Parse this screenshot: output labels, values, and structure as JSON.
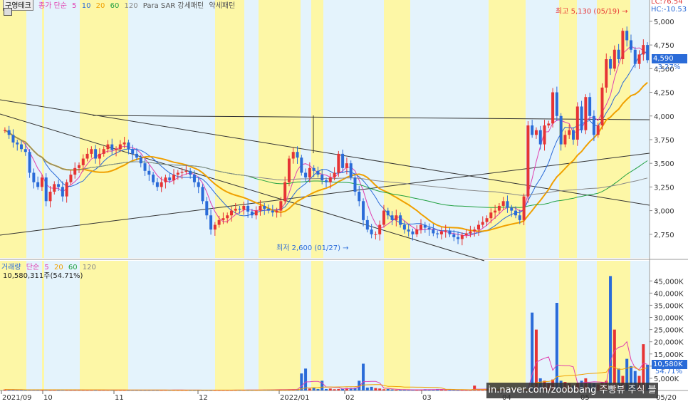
{
  "header": {
    "stock_name": "구영테크",
    "ma_label": "종가 단순",
    "ma_periods": [
      {
        "label": "5",
        "color": "#e040b0"
      },
      {
        "label": "10",
        "color": "#2a6bd8"
      },
      {
        "label": "20",
        "color": "#f0a000"
      },
      {
        "label": "60",
        "color": "#20a040"
      },
      {
        "label": "120",
        "color": "#888888"
      }
    ],
    "para_sar": "Para SAR 강세패턴",
    "weak": "약세패턴",
    "lc": "LC:76.54",
    "hc": "HC:-10.53"
  },
  "volume_header": {
    "label": "거래량",
    "ma_label": "단순",
    "periods": [
      {
        "label": "5",
        "color": "#e040b0"
      },
      {
        "label": "20",
        "color": "#f0a000"
      },
      {
        "label": "60",
        "color": "#20a040"
      },
      {
        "label": "120",
        "color": "#888888"
      }
    ],
    "summary": "10,580,311주(54.71%)"
  },
  "annotations": {
    "high": "최고 5,130 (05/19)",
    "low": "최저 2,600 (01/27)"
  },
  "current": {
    "price": "4,590",
    "pct": "-3.27%",
    "volume": "10,580K",
    "volume_pct": "54.71%"
  },
  "watermark": "in.naver.com/zoobbang 주빵뷰 주식 블로그",
  "colors": {
    "up": "#e63434",
    "down": "#2a6bd8",
    "band_yellow": "#fdf7a6",
    "band_blue": "#e4f3fc"
  },
  "chart_data": {
    "type": "candlestick",
    "price_axis": {
      "min": 2500,
      "max": 5150,
      "ticks": [
        "5,000",
        "4,750",
        "4,500",
        "4,250",
        "4,000",
        "3,750",
        "3,500",
        "3,250",
        "3,000",
        "2,750"
      ]
    },
    "volume_axis": {
      "min": 0,
      "max": 48000,
      "ticks": [
        "45,000K",
        "40,000K",
        "35,000K",
        "30,000K",
        "25,000K",
        "20,000K",
        "15,000K",
        "10,000K",
        "5,000K"
      ]
    },
    "x_labels": [
      "2021/09",
      "10",
      "11",
      "12",
      "2022/01",
      "02",
      "03",
      "04",
      "05",
      "05/20"
    ],
    "start_price": 3850,
    "closes": [
      3850,
      3800,
      3720,
      3700,
      3650,
      3620,
      3400,
      3300,
      3250,
      3350,
      3100,
      3200,
      3280,
      3250,
      3150,
      3300,
      3380,
      3450,
      3480,
      3550,
      3600,
      3650,
      3550,
      3600,
      3650,
      3700,
      3640,
      3650,
      3700,
      3720,
      3650,
      3600,
      3560,
      3500,
      3420,
      3380,
      3300,
      3250,
      3300,
      3350,
      3320,
      3380,
      3400,
      3410,
      3420,
      3380,
      3300,
      3250,
      3100,
      2950,
      2800,
      2850,
      2900,
      2920,
      2950,
      3000,
      3020,
      3010,
      3050,
      2990,
      2950,
      3000,
      3050,
      3020,
      3000,
      2980,
      3000,
      3100,
      3300,
      3550,
      3620,
      3560,
      3400,
      3350,
      3450,
      3420,
      3380,
      3320,
      3300,
      3350,
      3400,
      3600,
      3450,
      3500,
      3350,
      3200,
      3100,
      2900,
      2800,
      2750,
      2750,
      2850,
      3000,
      2950,
      2900,
      2950,
      2850,
      2800,
      2780,
      2750,
      2800,
      2850,
      2820,
      2800,
      2760,
      2750,
      2780,
      2790,
      2750,
      2720,
      2700,
      2740,
      2760,
      2780,
      2800,
      2850,
      2880,
      2920,
      2980,
      3000,
      3050,
      3100,
      3030,
      3000,
      2950,
      2900,
      3150,
      3900,
      3800,
      3850,
      3700,
      3900,
      3920,
      4250,
      4000,
      3700,
      3800,
      3850,
      3750,
      4100,
      3850,
      4200,
      4000,
      3800,
      3900,
      4300,
      4600,
      4500,
      4700,
      4600,
      4900,
      4800,
      4700,
      4550,
      4650,
      4750,
      4590
    ],
    "volumes": [
      400,
      350,
      300,
      280,
      250,
      250,
      300,
      280,
      260,
      240,
      280,
      260,
      250,
      240,
      300,
      280,
      260,
      250,
      240,
      230,
      220,
      210,
      200,
      210,
      220,
      230,
      200,
      190,
      180,
      170,
      180,
      190,
      180,
      170,
      160,
      160,
      170,
      180,
      190,
      200,
      210,
      200,
      190,
      180,
      170,
      160,
      150,
      150,
      140,
      140,
      130,
      140,
      150,
      160,
      170,
      180,
      190,
      200,
      210,
      220,
      230,
      250,
      280,
      300,
      320,
      350,
      380,
      400,
      420,
      450,
      500,
      600,
      7000,
      9000,
      800,
      1200,
      600,
      4000,
      600,
      800,
      500,
      600,
      700,
      1000,
      1000,
      1100,
      4000,
      11000,
      1200,
      1500,
      1000,
      800,
      500,
      600,
      400,
      300,
      300,
      300,
      250,
      300,
      250,
      300,
      500,
      400,
      300,
      600,
      400,
      200,
      200,
      300,
      200,
      200,
      200,
      200,
      2000,
      200,
      200,
      300,
      300,
      400,
      300,
      300,
      400,
      500,
      300,
      200,
      300,
      300,
      32000,
      25000,
      5000,
      4000,
      3000,
      4500,
      36000,
      4000,
      3500,
      3000,
      2000,
      3000,
      4000,
      5000,
      3000,
      3000,
      2500,
      3500,
      4000,
      47000,
      25000,
      9000,
      6000,
      13000,
      10000,
      8000,
      6000,
      19000,
      10580
    ]
  }
}
